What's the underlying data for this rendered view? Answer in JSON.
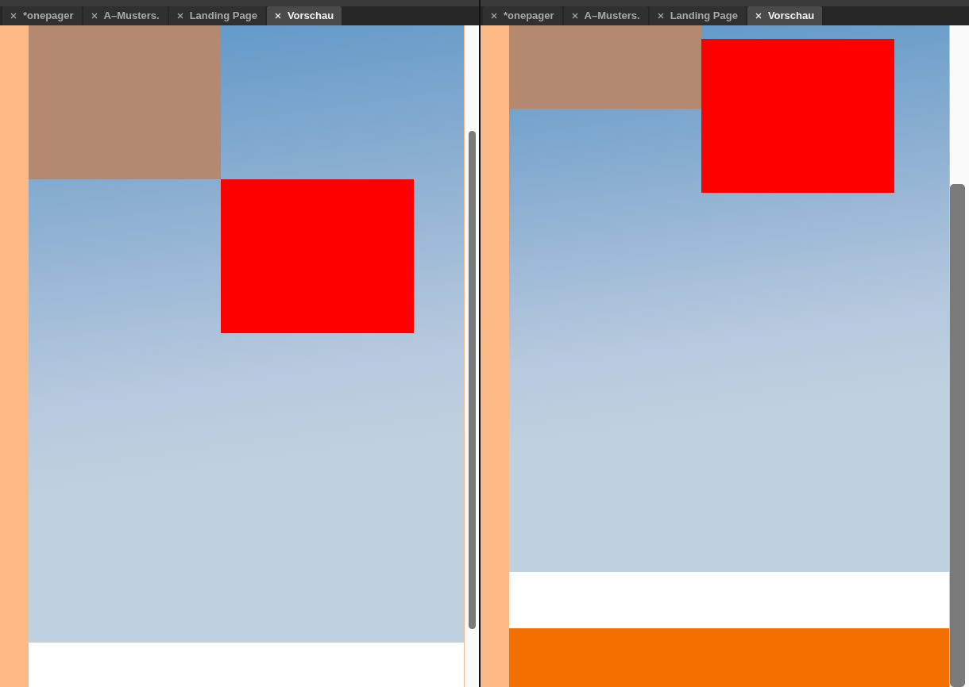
{
  "panes": [
    {
      "tabs": [
        {
          "label": "*onepager",
          "selected": false
        },
        {
          "label": "A–Musters.",
          "selected": false
        },
        {
          "label": "Landing Page",
          "selected": false
        },
        {
          "label": "Vorschau",
          "selected": true
        }
      ],
      "preview": {
        "kind": "upper"
      }
    },
    {
      "tabs": [
        {
          "label": "*onepager",
          "selected": false
        },
        {
          "label": "A–Musters.",
          "selected": false
        },
        {
          "label": "Landing Page",
          "selected": false
        },
        {
          "label": "Vorschau",
          "selected": true
        }
      ],
      "preview": {
        "kind": "lower"
      }
    }
  ]
}
